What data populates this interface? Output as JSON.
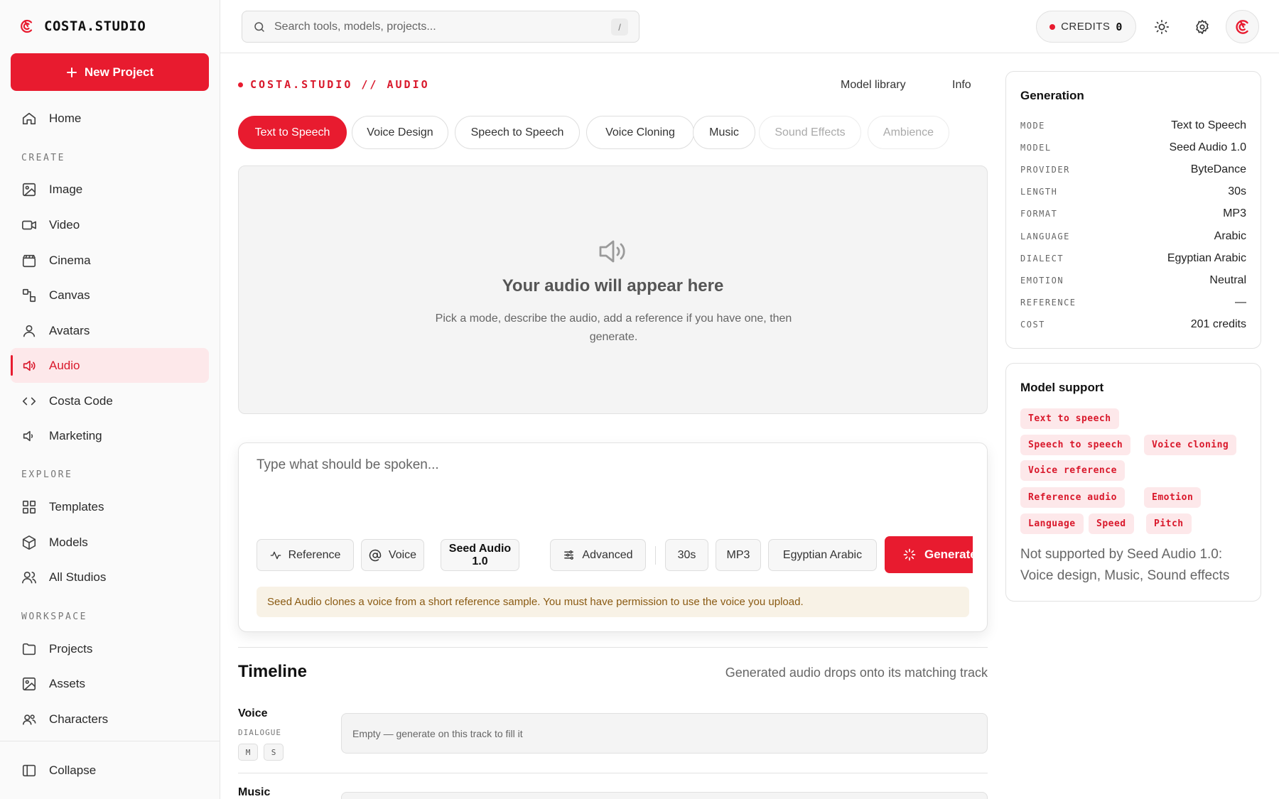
{
  "brand": {
    "name": "COSTA.STUDIO",
    "accent": "#e81b2f"
  },
  "sidebar": {
    "new_project": "New Project",
    "home": "Home",
    "sections": {
      "create": "CREATE",
      "explore": "EXPLORE",
      "workspace": "WORKSPACE"
    },
    "create_items": [
      {
        "label": "Image",
        "icon": "image-icon"
      },
      {
        "label": "Video",
        "icon": "video-icon"
      },
      {
        "label": "Cinema",
        "icon": "clapperboard-icon"
      },
      {
        "label": "Canvas",
        "icon": "canvas-icon"
      },
      {
        "label": "Avatars",
        "icon": "user-icon"
      },
      {
        "label": "Audio",
        "icon": "speaker-icon",
        "active": true
      },
      {
        "label": "Costa Code",
        "icon": "code-icon"
      },
      {
        "label": "Marketing",
        "icon": "megaphone-icon"
      }
    ],
    "explore_items": [
      {
        "label": "Templates",
        "icon": "grid-icon"
      },
      {
        "label": "Models",
        "icon": "cube-icon"
      },
      {
        "label": "All Studios",
        "icon": "users-icon"
      }
    ],
    "workspace_items": [
      {
        "label": "Projects",
        "icon": "folder-icon"
      },
      {
        "label": "Assets",
        "icon": "image-icon"
      },
      {
        "label": "Characters",
        "icon": "characters-icon"
      }
    ],
    "collapse": "Collapse"
  },
  "topbar": {
    "search_placeholder": "Search tools, models, projects...",
    "search_shortcut": "/",
    "credits_label": "CREDITS",
    "credits_value": "0"
  },
  "main": {
    "breadcrumb": "COSTA.STUDIO // AUDIO",
    "links": {
      "model_library": "Model library",
      "info": "Info"
    },
    "tabs": [
      {
        "label": "Text to Speech",
        "state": "active"
      },
      {
        "label": "Voice Design",
        "state": "normal"
      },
      {
        "label": "Speech to Speech",
        "state": "normal"
      },
      {
        "label": "Voice Cloning",
        "state": "normal"
      },
      {
        "label": "Music",
        "state": "normal"
      },
      {
        "label": "Sound Effects",
        "state": "disabled"
      },
      {
        "label": "Ambience",
        "state": "disabled"
      }
    ],
    "preview": {
      "title": "Your audio will appear here",
      "subtitle": "Pick a mode, describe the audio, add a reference if you have one, then generate."
    },
    "composer": {
      "placeholder": "Type what should be spoken...",
      "chips": {
        "reference": "Reference",
        "voice": "Voice",
        "model": "Seed Audio 1.0",
        "advanced": "Advanced",
        "length": "30s",
        "format": "MP3",
        "dialect": "Egyptian Arabic"
      },
      "generate": "Generate",
      "notice": "Seed Audio clones a voice from a short reference sample. You must have permission to use the voice you upload."
    },
    "timeline": {
      "title": "Timeline",
      "hint": "Generated audio drops onto its matching track",
      "tracks": [
        {
          "name": "Voice",
          "sub": "DIALOGUE",
          "mute": "M",
          "solo": "S",
          "empty": "Empty — generate on this track to fill it"
        },
        {
          "name": "Music"
        }
      ]
    }
  },
  "generation_panel": {
    "title": "Generation",
    "rows": [
      {
        "key": "MODE",
        "value": "Text to Speech"
      },
      {
        "key": "MODEL",
        "value": "Seed Audio 1.0"
      },
      {
        "key": "PROVIDER",
        "value": "ByteDance"
      },
      {
        "key": "LENGTH",
        "value": "30s"
      },
      {
        "key": "FORMAT",
        "value": "MP3"
      },
      {
        "key": "LANGUAGE",
        "value": "Arabic"
      },
      {
        "key": "DIALECT",
        "value": "Egyptian Arabic"
      },
      {
        "key": "EMOTION",
        "value": "Neutral"
      },
      {
        "key": "REFERENCE",
        "value": "—"
      },
      {
        "key": "COST",
        "value": "201 credits"
      }
    ]
  },
  "support_panel": {
    "title": "Model support",
    "tags": [
      "Text to speech",
      "Speech to speech",
      "Voice cloning",
      "Voice reference",
      "Reference audio",
      "Emotion",
      "Language",
      "Speed",
      "Pitch"
    ],
    "note": "Not supported by Seed Audio 1.0: Voice design, Music, Sound effects"
  }
}
